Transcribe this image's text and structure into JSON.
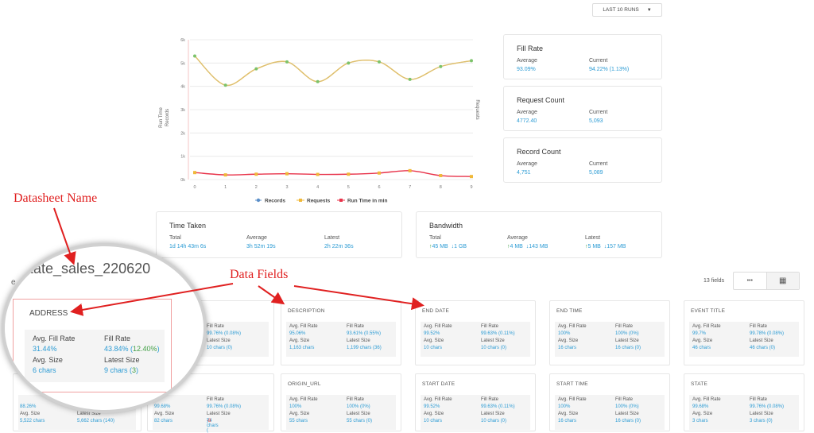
{
  "toolbar": {
    "runs_label": "LAST 10 RUNS"
  },
  "chart_data": {
    "type": "line",
    "x": [
      0,
      1,
      2,
      3,
      4,
      5,
      6,
      7,
      8,
      9
    ],
    "y_ticks": [
      "0k",
      "1k",
      "2k",
      "3k",
      "4k",
      "5k",
      "6k"
    ],
    "ylim": [
      0,
      6000
    ],
    "left_axis_label": "Run Time",
    "left_axis_label2": "Records",
    "right_axis_label": "Requests",
    "series": [
      {
        "name": "Records",
        "color": "#5b8fc9",
        "values": [
          5300,
          4050,
          4750,
          5050,
          4200,
          5000,
          5050,
          4300,
          4850,
          5100
        ]
      },
      {
        "name": "Requests",
        "color": "#f0b83a",
        "values": [
          5300,
          4050,
          4750,
          5050,
          4200,
          5000,
          5050,
          4300,
          4850,
          5100
        ]
      },
      {
        "name": "Run Time in min",
        "color": "#e8334a",
        "values": [
          300,
          200,
          230,
          250,
          220,
          230,
          280,
          380,
          170,
          130
        ]
      }
    ]
  },
  "metrics": {
    "fill_rate": {
      "title": "Fill Rate",
      "avg_label": "Average",
      "avg": "93.09%",
      "cur_label": "Current",
      "cur": "94.22% (1.13%)"
    },
    "request_count": {
      "title": "Request Count",
      "avg_label": "Average",
      "avg": "4772.40",
      "cur_label": "Current",
      "cur": "5,093"
    },
    "record_count": {
      "title": "Record Count",
      "avg_label": "Average",
      "avg": "4,751",
      "cur_label": "Current",
      "cur": "5,089"
    },
    "time_taken": {
      "title": "Time Taken",
      "total_label": "Total",
      "total": "1d 14h 43m 6s",
      "avg_label": "Average",
      "avg": "3h 52m 19s",
      "latest_label": "Latest",
      "latest": "2h 22m 36s"
    },
    "bandwidth": {
      "title": "Bandwidth",
      "total_label": "Total",
      "total_up": "45 MB",
      "total_down": "1 GB",
      "avg_label": "Average",
      "avg_up": "4 MB",
      "avg_down": "143 MB",
      "latest_label": "Latest",
      "latest_up": "5 MB",
      "latest_down": "157 MB"
    }
  },
  "fields_header": {
    "count": "13 fields",
    "list_icon": "•••",
    "grid_icon": "▦"
  },
  "labels": {
    "avg_fill": "Avg. Fill Rate",
    "fill": "Fill Rate",
    "avg_size": "Avg. Size",
    "latest_size": "Latest Size"
  },
  "fields": [
    {
      "name": "DESCRIPTION",
      "avg_fill": "95.06%",
      "fill": "93.61% (0.55%)",
      "avg_size": "1,163 chars",
      "latest_size": "1,199 chars (36)"
    },
    {
      "name": "END DATE",
      "avg_fill": "99.52%",
      "fill": "99.63% (0.11%)",
      "avg_size": "10 chars",
      "latest_size": "10 chars (0)"
    },
    {
      "name": "END TIME",
      "avg_fill": "100%",
      "fill": "100% (0%)",
      "avg_size": "16 chars",
      "latest_size": "16 chars (0)"
    },
    {
      "name": "EVENT TITLE",
      "avg_fill": "99.7%",
      "fill": "99.78% (0.08%)",
      "avg_size": "46 chars",
      "latest_size": "46 chars (0)"
    },
    {
      "name": "ORIGIN_URL",
      "avg_fill": "100%",
      "fill": "100% (0%)",
      "avg_size": "55 chars",
      "latest_size": "55 chars (0)"
    },
    {
      "name": "START DATE",
      "avg_fill": "99.52%",
      "fill": "99.63% (0.11%)",
      "avg_size": "10 chars",
      "latest_size": "10 chars (0)"
    },
    {
      "name": "START TIME",
      "avg_fill": "100%",
      "fill": "100% (0%)",
      "avg_size": "16 chars",
      "latest_size": "16 chars (0)"
    },
    {
      "name": "STATE",
      "avg_fill": "99.68%",
      "fill": "99.76% (0.08%)",
      "avg_size": "3 chars",
      "latest_size": "3 chars (0)"
    }
  ],
  "partial_fields": {
    "address_fill": "99.76% (0.08%)",
    "address_latest": "10 chars (0)",
    "bottom_left_avg_fill": "88.26%",
    "bottom_left_avg_size": "5,522 chars",
    "bottom_left_latest_size": "5,662 chars (140)",
    "bottom_mid_avg_fill": "99.68%",
    "bottom_mid_fill": "99.76% (0.08%)",
    "bottom_mid_avg_size": "82 chars",
    "bottom_mid_latest_size": "74 chars (-8)"
  },
  "zoom": {
    "datasheet_name": "estate_sales_220620",
    "field_name": "ADDRESS",
    "avg_fill": "31.44%",
    "fill": "43.84% (12.40%)",
    "avg_size": "6 chars",
    "latest_size": "9 chars (3)"
  },
  "annotations": {
    "datasheet": "Datasheet Name",
    "fields": "Data Fields"
  },
  "colors": {
    "accent": "#2b9bd4",
    "positive": "#43a047",
    "annotation": "#e02020"
  }
}
